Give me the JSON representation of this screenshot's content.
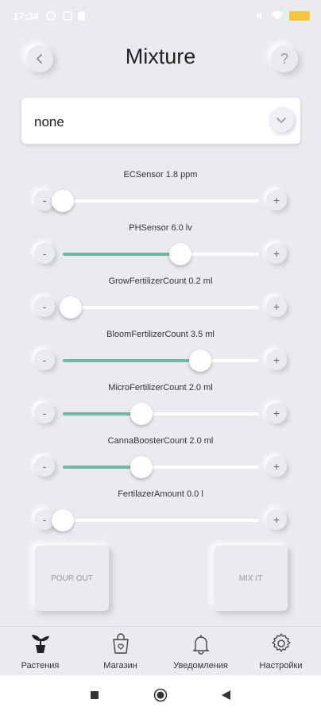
{
  "status": {
    "time": "17:34"
  },
  "header": {
    "back_icon": "chevron-left-icon",
    "title": "Mixture",
    "help_label": "?"
  },
  "dropdown": {
    "value": "none",
    "icon": "chevron-down-icon"
  },
  "sliders": [
    {
      "label": "ECSensor 1.8 ppm",
      "minus": "-",
      "plus": "+",
      "level": 0.0
    },
    {
      "label": "PHSensor 6.0 lv",
      "minus": "-",
      "plus": "+",
      "level": 0.6
    },
    {
      "label": "GrowFertilizerCount 0.2 ml",
      "minus": "-",
      "plus": "+",
      "level": 0.04
    },
    {
      "label": "BloomFertilizerCount 3.5 ml",
      "minus": "-",
      "plus": "+",
      "level": 0.7
    },
    {
      "label": "MicroFertilizerCount 2.0 ml",
      "minus": "-",
      "plus": "+",
      "level": 0.4
    },
    {
      "label": "CannaBoosterCount 2.0 ml",
      "minus": "-",
      "plus": "+",
      "level": 0.4
    },
    {
      "label": "FertilazerAmount 0.0 l",
      "minus": "-",
      "plus": "+",
      "level": 0.0
    }
  ],
  "actions": {
    "pour_out": "POUR OUT",
    "mix_it": "MIX IT"
  },
  "tabs": [
    {
      "label": "Растения",
      "icon": "plant-icon"
    },
    {
      "label": "Магазин",
      "icon": "shopping-bag-icon"
    },
    {
      "label": "Уведомления",
      "icon": "bell-icon"
    },
    {
      "label": "Настройки",
      "icon": "gear-icon"
    }
  ],
  "colors": {
    "accent": "#6fb8a6",
    "background": "#e9ebef"
  }
}
